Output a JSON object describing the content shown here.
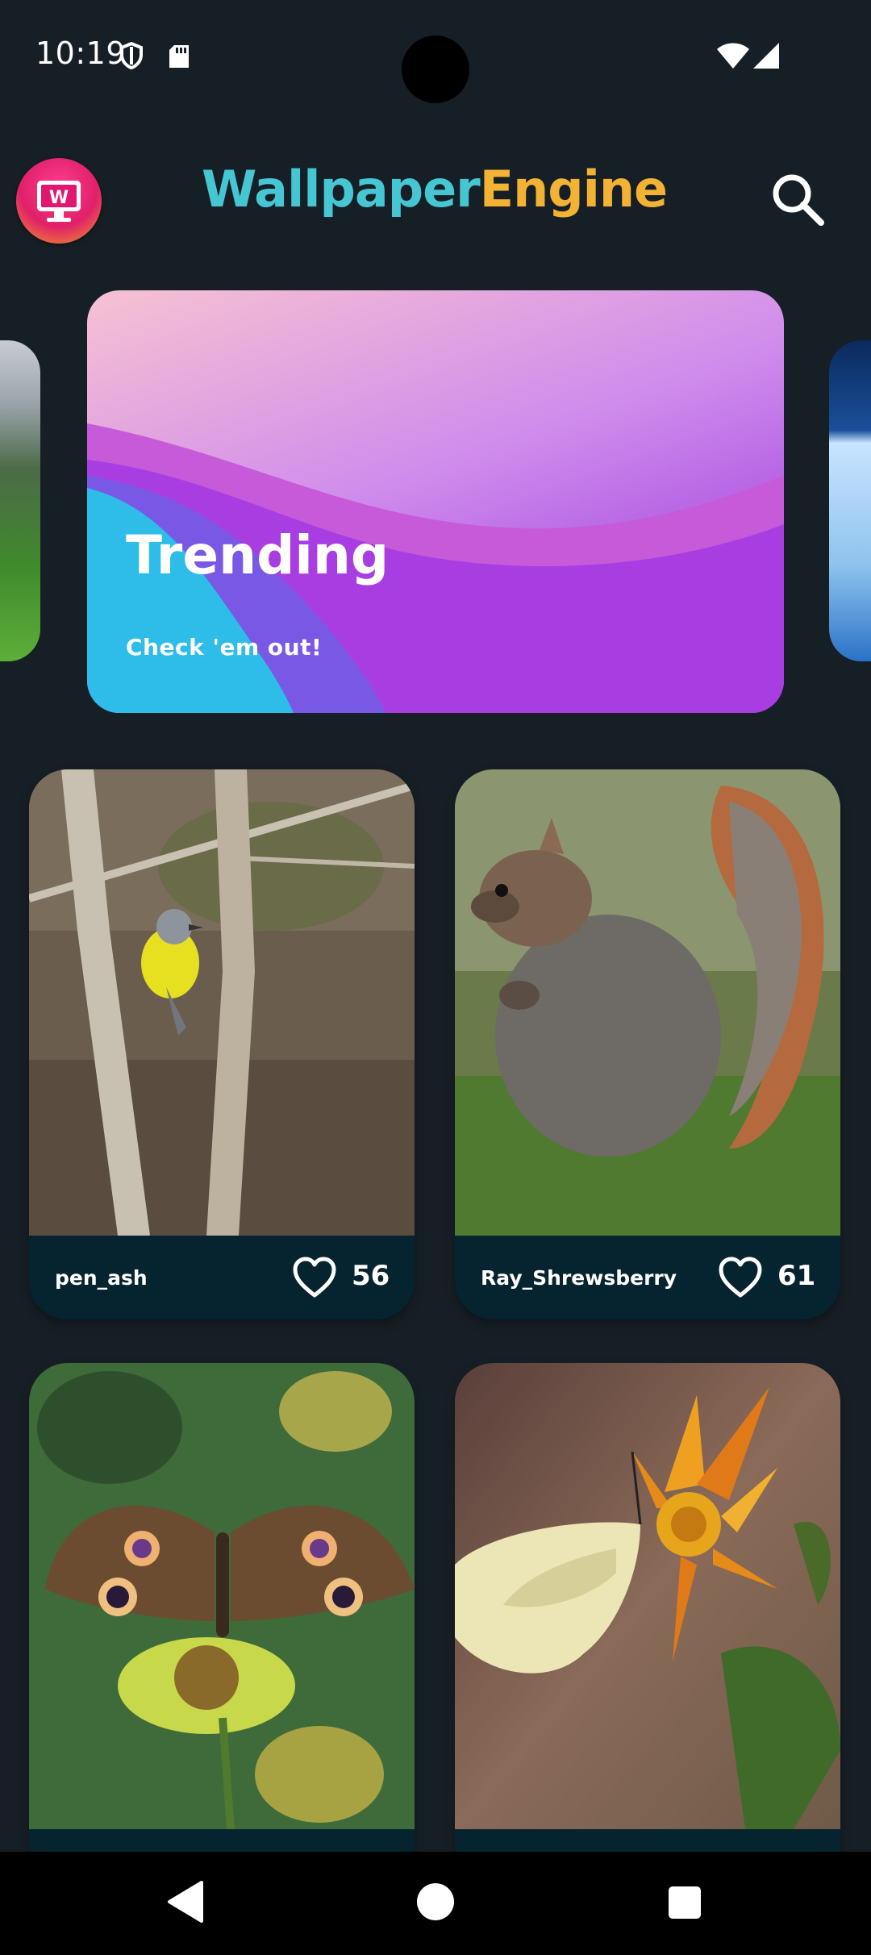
{
  "status_bar": {
    "time": "10:19",
    "icons": [
      "shield-icon",
      "sdcard-icon",
      "wifi-icon",
      "signal-icon"
    ]
  },
  "app_bar": {
    "title_part1": "Wallpaper",
    "title_part2": "Engine",
    "title_colors": [
      "#46c6d3",
      "#f2b233"
    ],
    "logo_icon": "monitor-w-icon",
    "search_icon": "search-icon"
  },
  "carousel": {
    "cards": [
      {
        "title": "Trending",
        "subtitle": "Check 'em out!"
      }
    ]
  },
  "wallpapers": [
    {
      "author": "pen_ash",
      "likes": "56",
      "image": "yellow-robin-on-tree"
    },
    {
      "author": "Ray_Shrewsberry",
      "likes": "61",
      "image": "squirrel-in-grass"
    },
    {
      "author": "",
      "likes": "",
      "image": "buckeye-butterfly-on-flower"
    },
    {
      "author": "",
      "likes": "",
      "image": "white-butterfly-on-orange-flower"
    }
  ],
  "nav_bar": {
    "icons": [
      "back-icon",
      "home-icon",
      "recents-icon"
    ]
  },
  "colors": {
    "background": "#171f26",
    "card_footer": "#062330",
    "accent_teal": "#46c6d3",
    "accent_gold": "#f2b233"
  }
}
